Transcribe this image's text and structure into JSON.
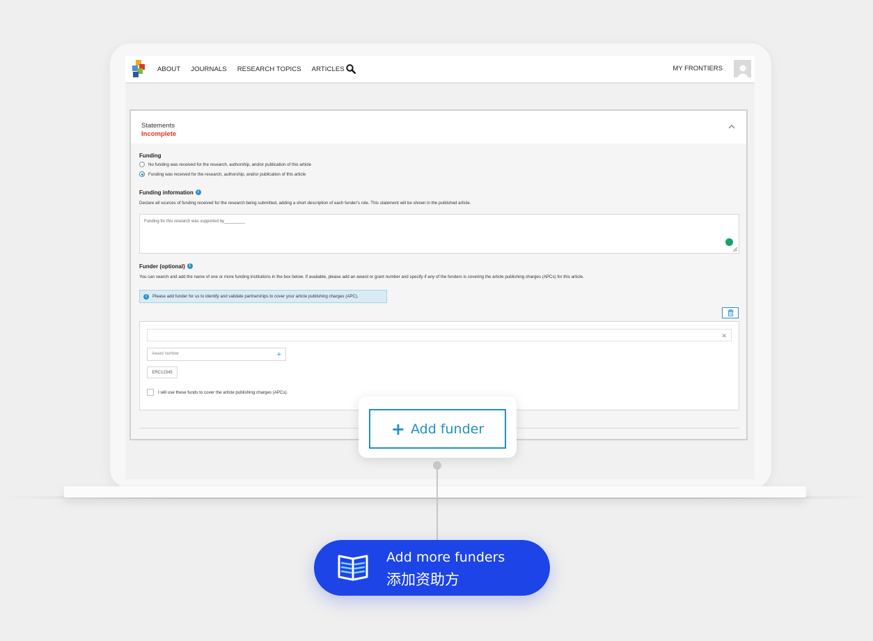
{
  "navbar": {
    "links": [
      "ABOUT",
      "JOURNALS",
      "RESEARCH TOPICS",
      "ARTICLES"
    ],
    "my_frontiers": "MY FRONTIERS"
  },
  "statements": {
    "title": "Statements",
    "status": "Incomplete",
    "status_color": "#e0341e"
  },
  "funding": {
    "label": "Funding",
    "options": [
      "No funding was received for the research, authorship, and/or publication of this article",
      "Funding was received for the research, authorship, and/or publication of this article"
    ],
    "selected_index": 1
  },
  "funding_information": {
    "label": "Funding information",
    "description": "Declare all sources of funding received for the research being submitted, adding a short description of each funder's role. This statement will be shown in the published article.",
    "value": "Funding for this research was supported by_________"
  },
  "funder": {
    "label": "Funder (optional)",
    "description": "You can search and add the name of one or more funding institutions in the box below. If available, please add an award or grant number and specify if any of the funders is covering the article publishing charges (APCs) for this article.",
    "info_banner": "Please add funder for us to identify and validate partnerships to cover your article publishing charges (APC).",
    "search_value": "",
    "award_placeholder": "Award number",
    "award_chip": "ERC12345",
    "apc_checkbox_label": "I will use these funds to cover the article publishing charges (APCs).",
    "apc_checked": false
  },
  "callout": {
    "button_label": "Add funder",
    "accent_color": "#1e90c2"
  },
  "tag": {
    "line1": "Add more funders",
    "line2": "添加资助方",
    "color": "#1d44e6"
  }
}
